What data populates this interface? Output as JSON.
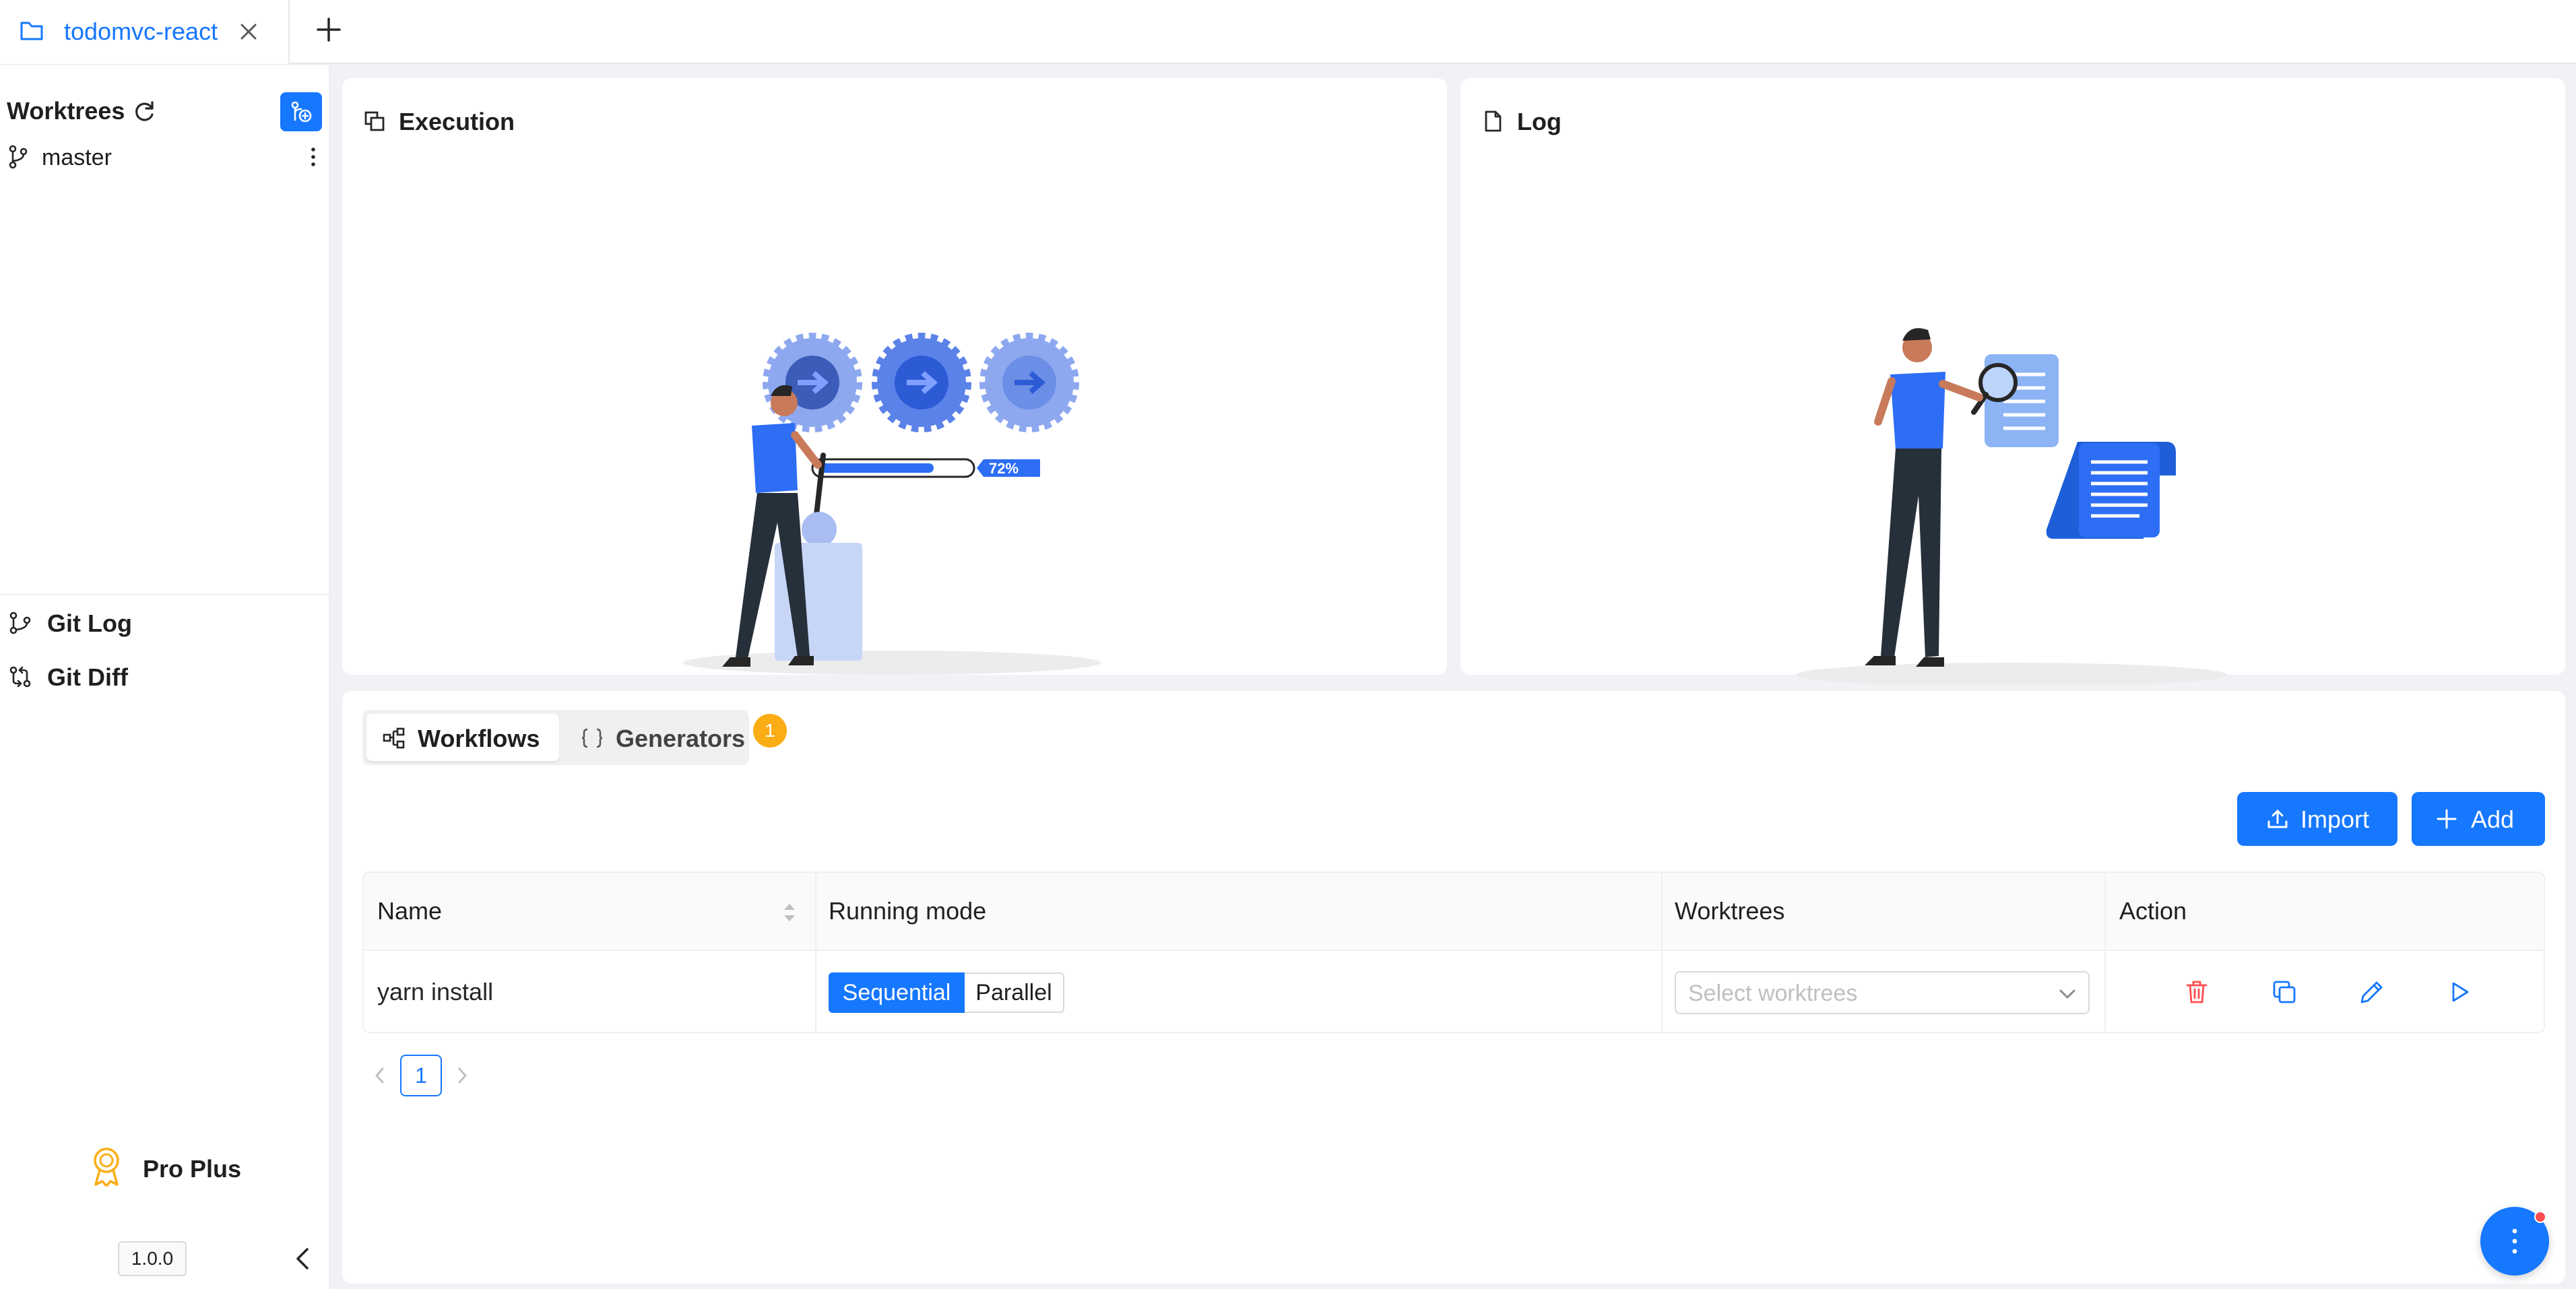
{
  "tabs": [
    {
      "label": "todomvc-react",
      "active": true,
      "icon": "folder-icon"
    }
  ],
  "sidebar": {
    "worktrees_title": "Worktrees",
    "worktrees": [
      {
        "label": "master",
        "icon": "git-branch-icon"
      }
    ],
    "links": [
      {
        "label": "Git Log",
        "icon": "git-log-icon"
      },
      {
        "label": "Git Diff",
        "icon": "git-diff-icon"
      }
    ],
    "plan": "Pro Plus",
    "version": "1.0.0"
  },
  "panels": {
    "execution_title": "Execution",
    "execution_progress": "72%",
    "log_title": "Log"
  },
  "workflows": {
    "tabs": [
      {
        "label": "Workflows",
        "icon": "workflow-icon",
        "selected": true
      },
      {
        "label": "Generators",
        "icon": "braces-icon",
        "selected": false,
        "badge": "1"
      }
    ],
    "import_label": "Import",
    "add_label": "Add",
    "columns": [
      "Name",
      "Running mode",
      "Worktrees",
      "Action"
    ],
    "rows": [
      {
        "name": "yarn install",
        "modes": [
          "Sequential",
          "Parallel"
        ],
        "selected_mode": "Sequential",
        "worktrees_placeholder": "Select worktrees",
        "actions": [
          "delete-icon",
          "copy-icon",
          "edit-icon",
          "run-icon"
        ]
      }
    ],
    "page": "1"
  },
  "colors": {
    "primary": "#1677ff",
    "badge": "#faad14",
    "danger": "#ff4d4f",
    "background": "#f0f2f5"
  }
}
